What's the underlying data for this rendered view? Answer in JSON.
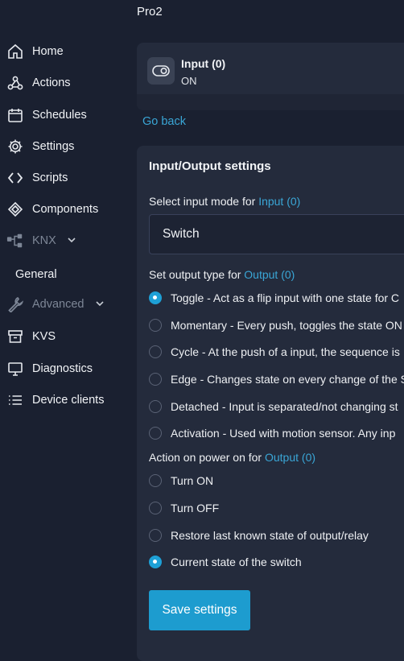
{
  "device": {
    "title": "Pro2"
  },
  "sidebar": {
    "items": [
      {
        "label": "Home",
        "icon": "home-icon"
      },
      {
        "label": "Actions",
        "icon": "webhook-icon"
      },
      {
        "label": "Schedules",
        "icon": "calendar-icon"
      },
      {
        "label": "Settings",
        "icon": "gear-icon"
      },
      {
        "label": "Scripts",
        "icon": "code-icon"
      },
      {
        "label": "Components",
        "icon": "components-icon"
      },
      {
        "label": "KNX",
        "icon": "network-icon"
      },
      {
        "label": "General"
      },
      {
        "label": "Advanced",
        "icon": "wrench-icon"
      },
      {
        "label": "KVS",
        "icon": "archive-icon"
      },
      {
        "label": "Diagnostics",
        "icon": "monitor-icon"
      },
      {
        "label": "Device clients",
        "icon": "list-icon"
      }
    ]
  },
  "component": {
    "name": "Input (0)",
    "state": "ON",
    "icon": "toggle-icon"
  },
  "go_back": "Go back",
  "settings": {
    "title": "Input/Output settings",
    "input_mode_label": "Select input mode for",
    "input_link": "Input (0)",
    "input_mode_value": "Switch",
    "output_type_label": "Set output type for",
    "output_link": "Output (0)",
    "output_types": [
      {
        "text": "Toggle - Act as a flip input with one state for C",
        "selected": true
      },
      {
        "text": "Momentary - Every push, toggles the state ON",
        "selected": false
      },
      {
        "text": "Cycle - At the push of a input, the sequence is",
        "selected": false
      },
      {
        "text": "Edge - Changes state on every change of the S",
        "selected": false
      },
      {
        "text": "Detached - Input is separated/not changing st",
        "selected": false
      },
      {
        "text": "Activation - Used with motion sensor. Any inp",
        "selected": false
      }
    ],
    "power_on_label": "Action on power on for",
    "power_on_link": "Output (0)",
    "power_on_options": [
      {
        "text": "Turn ON",
        "selected": false
      },
      {
        "text": "Turn OFF",
        "selected": false
      },
      {
        "text": "Restore last known state of output/relay",
        "selected": false
      },
      {
        "text": "Current state of the switch",
        "selected": true
      }
    ],
    "save_label": "Save settings"
  },
  "colors": {
    "accent": "#1ea0d6",
    "link": "#3aa6d6",
    "background": "#1a2030",
    "card": "#242b3c"
  }
}
